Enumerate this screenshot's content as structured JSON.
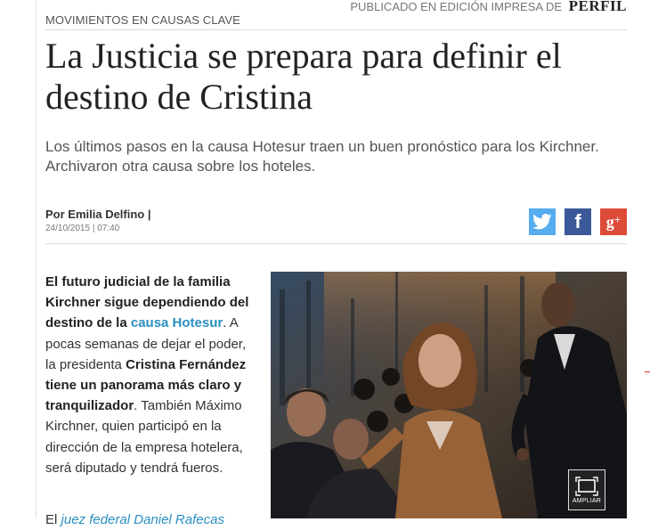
{
  "article": {
    "section": "MOVIMIENTOS EN CAUSAS CLAVE",
    "edition_label": "PUBLICADO EN EDICIÓN IMPRESA DE",
    "brand": "PERFIL",
    "headline": "La Justicia se prepara para definir el destino de Cristina",
    "subhead": "Los últimos pasos en la causa Hotesur traen un buen pronóstico para los Kirchner. Archivaron otra causa sobre los hoteles.",
    "byline": "Por Emilia Delfino |",
    "date": "24/10/2015 | 07:40"
  },
  "share": {
    "twitter_icon": "twitter-icon",
    "facebook_glyph": "f",
    "gplus_glyph": "g",
    "gplus_plus": "+"
  },
  "body": {
    "p1_s1": "E",
    "p1_s2": "l futuro judicial de la familia Kirchner sigue dependiendo del destino de la ",
    "p1_link": "causa Hotesur",
    "p1_s3": ". A pocas semanas de dejar el poder, la presidenta ",
    "p1_s4": "Cristina Fernández tiene un panorama más claro y tranquilizador",
    "p1_s5": ". También Máximo Kirchner, quien participó en la dirección de la empresa hotelera, será diputado y tendrá fueros.",
    "p2_start": "El ",
    "p2_link": "juez federal Daniel Rafecas"
  },
  "photo": {
    "enlarge_label": "AMPLIAR"
  },
  "colors": {
    "link": "#2a8fc1",
    "twitter": "#55acee",
    "facebook": "#3b5998",
    "gplus": "#dd4b39"
  }
}
